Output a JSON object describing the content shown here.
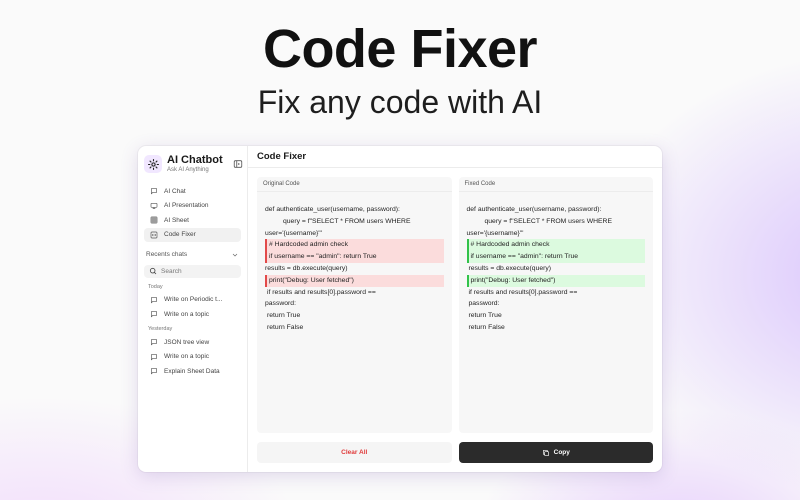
{
  "hero": {
    "title": "Code Fixer",
    "subtitle": "Fix any code with AI"
  },
  "sidebar": {
    "app_name": "AI Chatbot",
    "tagline": "Ask AI Anything",
    "nav": [
      {
        "label": "AI Chat",
        "icon": "chat-icon"
      },
      {
        "label": "AI Presentation",
        "icon": "presentation-icon"
      },
      {
        "label": "AI Sheet",
        "icon": "sheet-icon"
      },
      {
        "label": "Code Fixer",
        "icon": "code-icon",
        "active": true
      }
    ],
    "recent_label": "Recents chats",
    "search_placeholder": "Search",
    "groups": [
      {
        "label": "Today",
        "items": [
          "Write on Periodic t...",
          "Write on a topic"
        ]
      },
      {
        "label": "Yesterday",
        "items": [
          "JSON tree view",
          "Write on a topic",
          "Explain Sheet Data"
        ]
      }
    ]
  },
  "main": {
    "title": "Code Fixer",
    "original": {
      "label": "Original Code",
      "lines": [
        "def authenticate_user(username, password):",
        "query = f\"SELECT * FROM users WHERE",
        "user='{username}'\"",
        "# Hardcoded admin check",
        "if username == \"admin\": return True",
        "results = db.execute(query)",
        "print(\"Debug: User fetched\")",
        "if results and results[0].password ==",
        "password:",
        "return True",
        "return False"
      ]
    },
    "fixed": {
      "label": "Fixed Code",
      "lines": [
        "def authenticate_user(username, password):",
        "query = f\"SELECT * FROM users WHERE",
        "user='{username}'\"",
        "# Hardcoded admin check",
        "if username == \"admin\": return True",
        "results = db.execute(query)",
        "print(\"Debug: User fetched\")",
        "if results and results[0].password ==",
        "password:",
        "return True",
        "return False"
      ]
    },
    "clear_label": "Clear All",
    "copy_label": "Copy"
  },
  "colors": {
    "removed": "#fbdcdc",
    "added": "#dcfadf",
    "clear_text": "#e03b3b",
    "copy_bg": "#2b2b2b"
  }
}
